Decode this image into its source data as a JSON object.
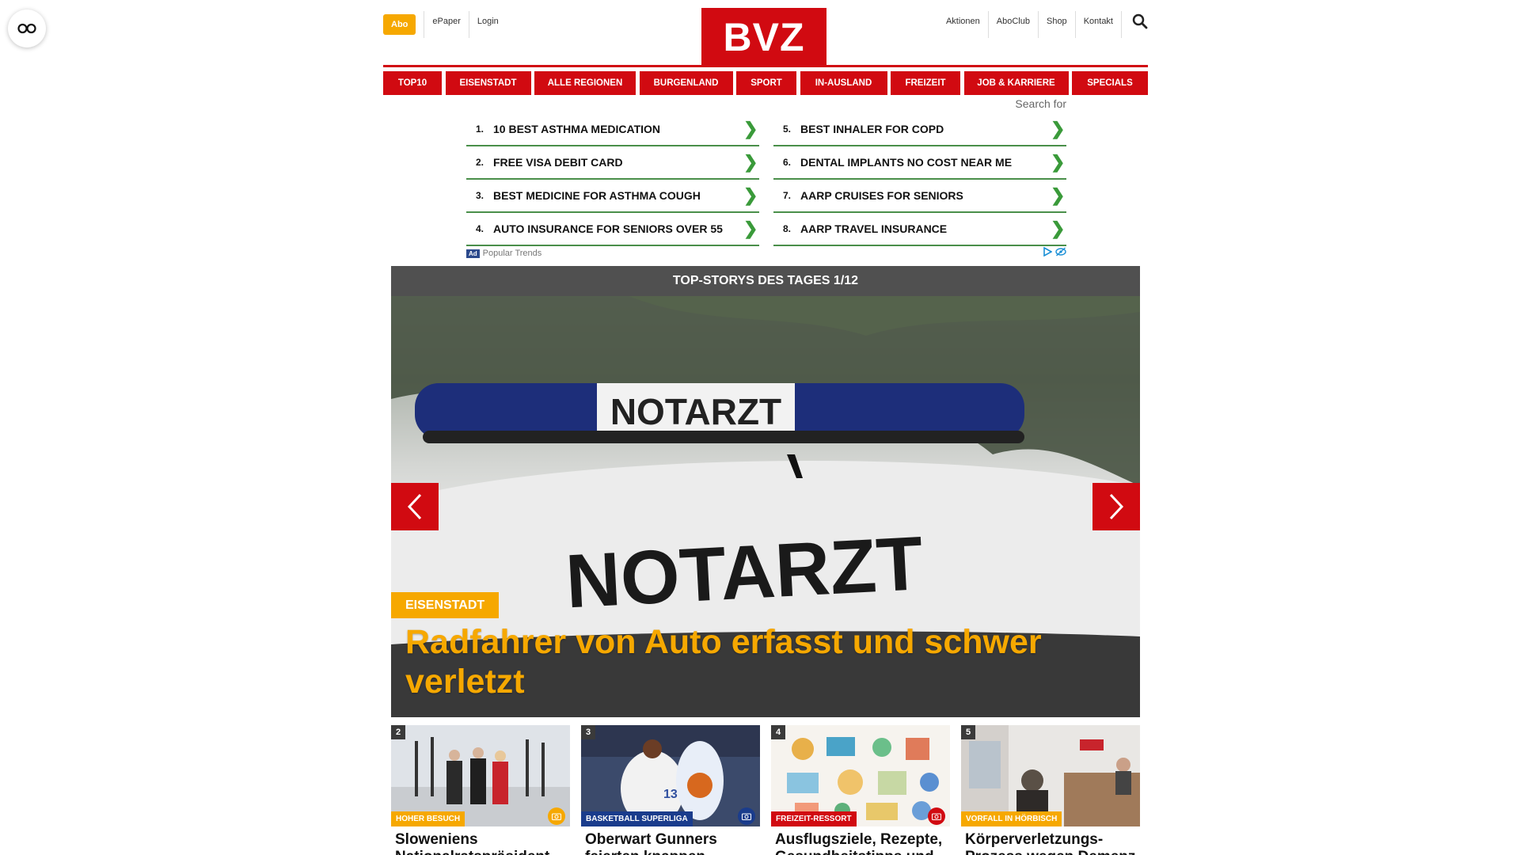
{
  "reader_button": {
    "icon": "glasses-icon"
  },
  "header": {
    "abo_label": "Abo",
    "epaper_label": "ePaper",
    "login_label": "Login",
    "logo_text": "BVZ",
    "right_links": [
      "Aktionen",
      "AboClub",
      "Shop",
      "Kontakt"
    ],
    "search_icon": "search-icon",
    "brand_color": "#d10a11",
    "accent_color": "#f6a800"
  },
  "nav": {
    "items": [
      "TOP10",
      "EISENSTADT",
      "ALLE REGIONEN",
      "BURGENLAND",
      "SPORT",
      "IN-AUSLAND",
      "FREIZEIT",
      "JOB & KARRIERE",
      "SPECIALS"
    ]
  },
  "ads": {
    "search_for": "Search for",
    "left": [
      {
        "num": "1.",
        "text": "10 BEST ASTHMA MEDICATION"
      },
      {
        "num": "2.",
        "text": "FREE VISA DEBIT CARD"
      },
      {
        "num": "3.",
        "text": "BEST MEDICINE FOR ASTHMA COUGH"
      },
      {
        "num": "4.",
        "text": "AUTO INSURANCE FOR SENIORS OVER 55"
      }
    ],
    "right": [
      {
        "num": "5.",
        "text": "BEST INHALER FOR COPD"
      },
      {
        "num": "6.",
        "text": "DENTAL IMPLANTS NO COST NEAR ME"
      },
      {
        "num": "7.",
        "text": "AARP CRUISES FOR SENIORS"
      },
      {
        "num": "8.",
        "text": "AARP TRAVEL INSURANCE"
      }
    ],
    "chevron": "❯",
    "badge": "Ad",
    "footer_label": "Popular Trends"
  },
  "slider": {
    "heading": "TOP-STORYS DES TAGES 1/12",
    "image_text_small": "NOTARZT",
    "image_text_large": "NOTARZT",
    "tag": "EISENSTADT",
    "title": "Radfahrer von Auto erfasst und schwer verletzt",
    "prev_icon": "chevron-left-icon",
    "next_icon": "chevron-right-icon"
  },
  "cards": [
    {
      "num": "2",
      "tag": "HOHER BESUCH",
      "tag_color": "#f6a800",
      "title": "Sloweniens Nationalratspräsident",
      "cam_color": "#f6a800"
    },
    {
      "num": "3",
      "tag": "BASKETBALL SUPERLIGA",
      "tag_color": "#1a3c8c",
      "title": "Oberwart Gunners feierten knappen",
      "cam_color": "#1a3c8c"
    },
    {
      "num": "4",
      "tag": "FREIZEIT-RESSORT",
      "tag_color": "#d10a11",
      "title": "Ausflugsziele, Rezepte, Gesundheitstipps und",
      "cam_color": "#d10a11"
    },
    {
      "num": "5",
      "tag": "VORFALL IN HÖRBISCH",
      "tag_color": "#f6a800",
      "title": "Körperverletzungs-Prozess wegen Demenz",
      "cam_color": "#f6a800"
    }
  ]
}
